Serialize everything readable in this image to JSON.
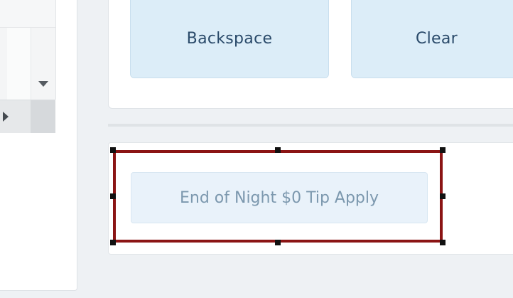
{
  "keypad": {
    "backspace_label": "Backspace",
    "clear_label": "Clear"
  },
  "actions": {
    "tip_button_label": "End of Night $0 Tip Apply"
  },
  "colors": {
    "key_background": "#dcedf8",
    "key_text": "#2a4a6a",
    "tip_button_background": "#e9f2fa",
    "tip_button_text": "#7c98ae",
    "selection_border": "#8b1414",
    "page_background": "#eef1f4"
  },
  "icons": {
    "dropdown": "caret-down-icon",
    "scroll_right": "caret-right-icon"
  }
}
